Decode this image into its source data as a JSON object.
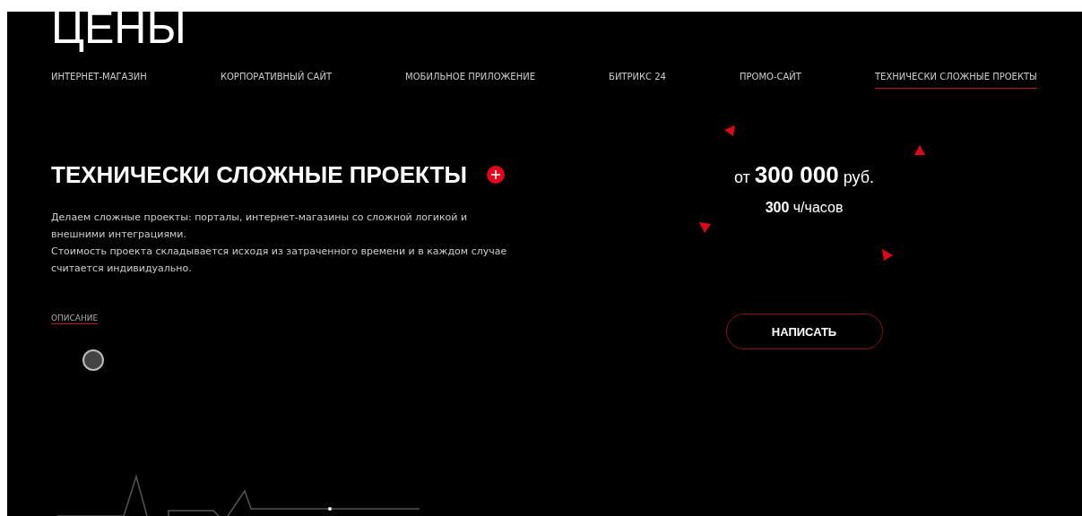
{
  "title": "ЦЕНЫ",
  "tabs": [
    {
      "label": "ИНТЕРНЕТ-МАГАЗИН",
      "selected": false
    },
    {
      "label": "КОРПОРАТИВНЫЙ САЙТ",
      "selected": false
    },
    {
      "label": "МОБИЛЬНОЕ ПРИЛОЖЕНИЕ",
      "selected": false
    },
    {
      "label": "БИТРИКС 24",
      "selected": false
    },
    {
      "label": "ПРОМО-САЙТ",
      "selected": false
    },
    {
      "label": "ТЕХНИЧЕСКИ СЛОЖНЫЕ ПРОЕКТЫ",
      "selected": true
    }
  ],
  "project": {
    "heading": "ТЕХНИЧЕСКИ СЛОЖНЫЕ ПРОЕКТЫ",
    "paragraphs": [
      "Делаем сложные проекты: порталы, интернет-магазины со сложной логикой и внешними интеграциями.",
      "Стоимость проекта складывается исходя из затраченного времени и в каждом случае считается индивидуально."
    ],
    "link": "ОПИСАНИЕ"
  },
  "price": {
    "prefix": "от",
    "amount": "300 000",
    "unit": "руб."
  },
  "hours": {
    "amount": "300",
    "unit": "ч/часов"
  },
  "button": "НАПИСАТЬ"
}
